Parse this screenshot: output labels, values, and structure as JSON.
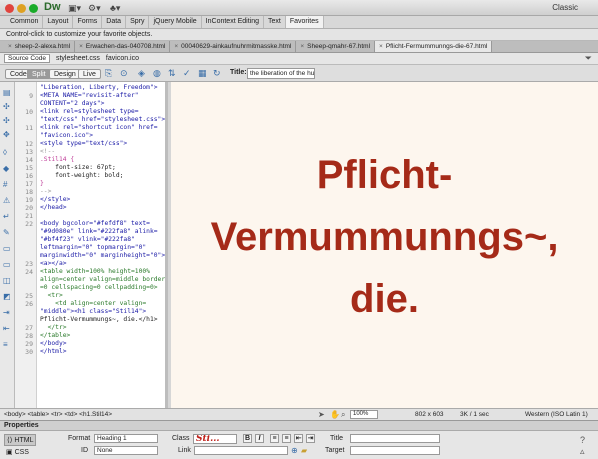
{
  "app": {
    "logo": "Dw",
    "workspace": "Classic"
  },
  "insert_tabs": [
    "Common",
    "Layout",
    "Forms",
    "Data",
    "Spry",
    "jQuery Mobile",
    "InContext Editing",
    "Text",
    "Favorites"
  ],
  "insert_active": "Favorites",
  "ctrl_hint": "Control-click to customize your favorite objects.",
  "doc_tabs": [
    "sheep-2-alexa.html",
    "Erwachen-das-040708.html",
    "00040629-ainkaufnuhrmitmasske.html",
    "Sheep-qmahr-67.html",
    "Pflicht-Fermummunngs-die-67.html"
  ],
  "doc_tab_active": 4,
  "related_files": {
    "source": "Source Code",
    "files": [
      "stylesheet.css",
      "favicon.ico"
    ]
  },
  "doc_toolbar": {
    "code": "Code",
    "split": "Split",
    "design": "Design",
    "live": "Live",
    "title_label": "Title:",
    "title_value": "the liberation of the human is"
  },
  "code_lines": [
    {
      "n": "",
      "text": "\"Liberation, Liberty, Freedom\">",
      "cls": "c-tag"
    },
    {
      "n": "9",
      "text": "<META NAME=\"revisit-after\"",
      "cls": "c-tag"
    },
    {
      "n": "",
      "text": "CONTENT=\"2 days\">",
      "cls": "c-tag"
    },
    {
      "n": "10",
      "text": "<link rel=stylesheet type=",
      "cls": "c-tag"
    },
    {
      "n": "",
      "text": "\"text/css\" href=\"stylesheet.css\">",
      "cls": "c-tag"
    },
    {
      "n": "11",
      "text": "<link rel=\"shortcut icon\" href=",
      "cls": "c-tag"
    },
    {
      "n": "",
      "text": "\"favicon.ico\">",
      "cls": "c-tag"
    },
    {
      "n": "12",
      "text": "<style type=\"text/css\">",
      "cls": "c-tag"
    },
    {
      "n": "13",
      "text": "<!--",
      "cls": "c-gray"
    },
    {
      "n": "14",
      "text": ".Stil14 {",
      "cls": "c-pink"
    },
    {
      "n": "15",
      "text": "    font-size: 67pt;",
      "cls": ""
    },
    {
      "n": "16",
      "text": "    font-weight: bold;",
      "cls": ""
    },
    {
      "n": "17",
      "text": "}",
      "cls": "c-pink"
    },
    {
      "n": "18",
      "text": "-->",
      "cls": "c-gray"
    },
    {
      "n": "19",
      "text": "</style>",
      "cls": "c-tag"
    },
    {
      "n": "20",
      "text": "</head>",
      "cls": "c-tag"
    },
    {
      "n": "21",
      "text": "",
      "cls": ""
    },
    {
      "n": "22",
      "text": "<body bgcolor=\"#fefdf8\" text=",
      "cls": "c-tag"
    },
    {
      "n": "",
      "text": "\"#9d080e\" link=\"#222fa8\" alink=",
      "cls": "c-tag"
    },
    {
      "n": "",
      "text": "\"#bf4f23\" vlink=\"#222fa8\"",
      "cls": "c-tag"
    },
    {
      "n": "",
      "text": "leftmargin=\"0\" topmargin=\"0\"",
      "cls": "c-tag"
    },
    {
      "n": "",
      "text": "marginwidth=\"0\" marginheight=\"0\">",
      "cls": "c-tag"
    },
    {
      "n": "23",
      "text": "<a></a>",
      "cls": "c-tag"
    },
    {
      "n": "24",
      "text": "<table width=100% height=100%",
      "cls": "c-green"
    },
    {
      "n": "",
      "text": "align=center valign=middle border",
      "cls": "c-green"
    },
    {
      "n": "",
      "text": "=0 cellspacing=0 cellpadding=0>",
      "cls": "c-green"
    },
    {
      "n": "25",
      "text": "  <tr>",
      "cls": "c-green"
    },
    {
      "n": "26",
      "text": "    <td align=center valign=",
      "cls": "c-green"
    },
    {
      "n": "",
      "text": "\"middle\"><h1 class=\"Stil14\">",
      "cls": "c-tag"
    },
    {
      "n": "",
      "text": "Pflicht-Vermummungs~, die.</h1>",
      "cls": ""
    },
    {
      "n": "27",
      "text": "  </tr>",
      "cls": "c-green"
    },
    {
      "n": "28",
      "text": "</table>",
      "cls": "c-green"
    },
    {
      "n": "29",
      "text": "</body>",
      "cls": "c-tag"
    },
    {
      "n": "30",
      "text": "</html>",
      "cls": "c-tag"
    }
  ],
  "design": {
    "heading_lines": [
      "Pflicht-",
      "Vermummunngs~,",
      "die."
    ],
    "text_color": "#a52a18",
    "bg_color": "#fdf6ee"
  },
  "statusbar": {
    "tags": "<body> <table> <tr> <td> <h1.Stil14>",
    "zoom": "100%",
    "window_size": "802 x 603",
    "file_size": "3K / 1 sec",
    "encoding": "Western (ISO Latin 1)"
  },
  "properties": {
    "title": "Properties",
    "html_mode": "HTML",
    "css_mode": "CSS",
    "format_label": "Format",
    "format_value": "Heading 1",
    "id_label": "ID",
    "id_value": "None",
    "class_label": "Class",
    "class_sample": "Sti...",
    "link_label": "Link",
    "title_label": "Title",
    "target_label": "Target",
    "bold": "B",
    "italic": "I"
  }
}
